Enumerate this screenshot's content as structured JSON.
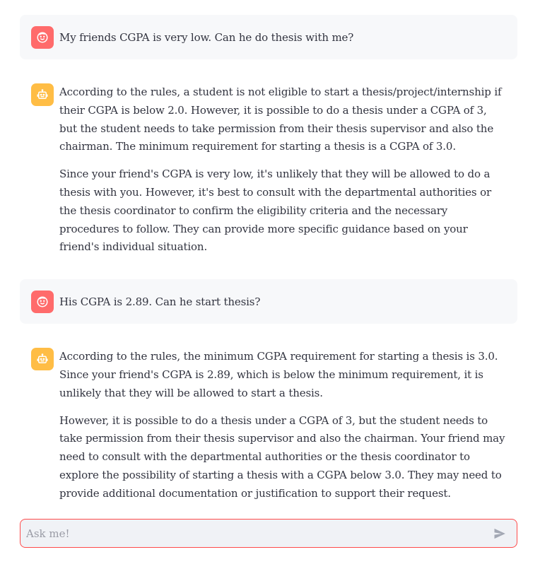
{
  "messages": [
    {
      "role": "user",
      "avatar_icon": "face-icon",
      "paragraphs": [
        "My friends CGPA is very low. Can he do thesis with me?"
      ]
    },
    {
      "role": "assistant",
      "avatar_icon": "robot-icon",
      "paragraphs": [
        "According to the rules, a student is not eligible to start a thesis/project/internship if their CGPA is below 2.0. However, it is possible to do a thesis under a CGPA of 3, but the student needs to take permission from their thesis supervisor and also the chairman. The minimum requirement for starting a thesis is a CGPA of 3.0.",
        "Since your friend's CGPA is very low, it's unlikely that they will be allowed to do a thesis with you. However, it's best to consult with the departmental authorities or the thesis coordinator to confirm the eligibility criteria and the necessary procedures to follow. They can provide more specific guidance based on your friend's individual situation."
      ]
    },
    {
      "role": "user",
      "avatar_icon": "face-icon",
      "paragraphs": [
        "His CGPA is 2.89. Can he start thesis?"
      ]
    },
    {
      "role": "assistant",
      "avatar_icon": "robot-icon",
      "paragraphs": [
        "According to the rules, the minimum CGPA requirement for starting a thesis is 3.0. Since your friend's CGPA is 2.89, which is below the minimum requirement, it is unlikely that they will be allowed to start a thesis.",
        "However, it is possible to do a thesis under a CGPA of 3, but the student needs to take permission from their thesis supervisor and also the chairman. Your friend may need to consult with the departmental authorities or the thesis coordinator to explore the possibility of starting a thesis with a CGPA below 3.0. They may need to provide additional documentation or justification to support their request."
      ]
    }
  ],
  "chat_input": {
    "value": "",
    "placeholder": "Ask me!",
    "send_icon": "send-icon"
  },
  "colors": {
    "user_avatar": "#ff6b6b",
    "assistant_avatar": "#ffbd45",
    "user_bubble": "#f7f8fa",
    "input_border": "#ff4b4b",
    "input_bg": "#f0f2f6"
  }
}
